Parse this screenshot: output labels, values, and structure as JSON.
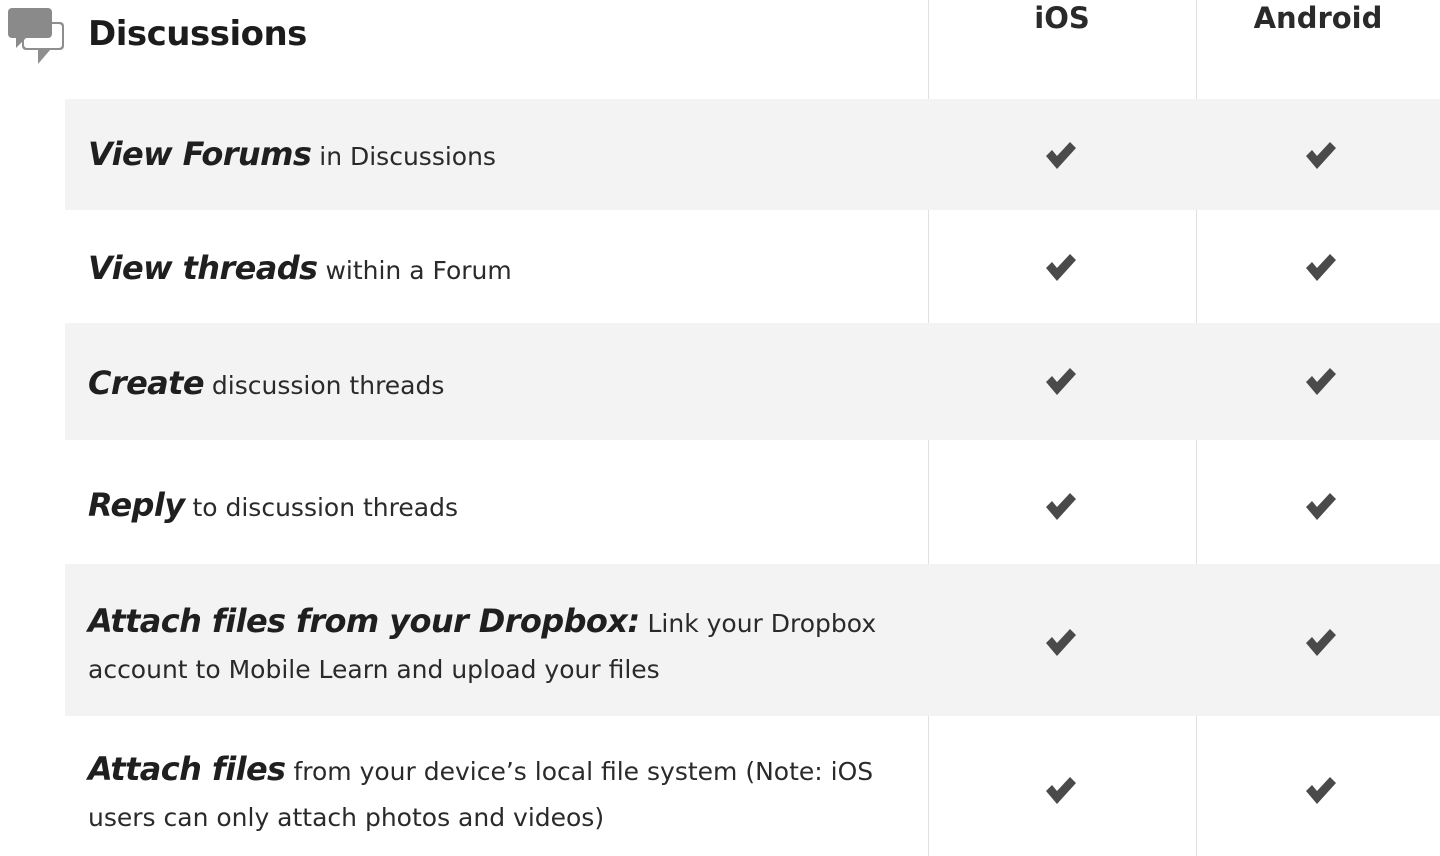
{
  "section": {
    "title": "Discussions",
    "icon": "chat-bubbles-icon"
  },
  "columns": {
    "ios": "iOS",
    "android": "Android"
  },
  "colors": {
    "shaded_row": "#f3f3f3",
    "check": "#4a4a4a",
    "icon_back": "#9a9a9a",
    "icon_front": "#7b7b7b"
  },
  "rows": [
    {
      "emphasis": "View Forums",
      "rest": " in Discussions",
      "ios": true,
      "android": true
    },
    {
      "emphasis": "View threads",
      "rest": " within a Forum",
      "ios": true,
      "android": true
    },
    {
      "emphasis": "Create",
      "rest": " discussion threads",
      "ios": true,
      "android": true
    },
    {
      "emphasis": "Reply",
      "rest": " to discussion threads",
      "ios": true,
      "android": true
    },
    {
      "emphasis": "Attach files from your Dropbox:",
      "rest": " Link your Dropbox account to Mobile Learn and upload your files",
      "ios": true,
      "android": true
    },
    {
      "emphasis": "Attach files",
      "rest": " from your device’s local file system (Note: iOS users can only attach photos and videos)",
      "ios": true,
      "android": true
    }
  ]
}
